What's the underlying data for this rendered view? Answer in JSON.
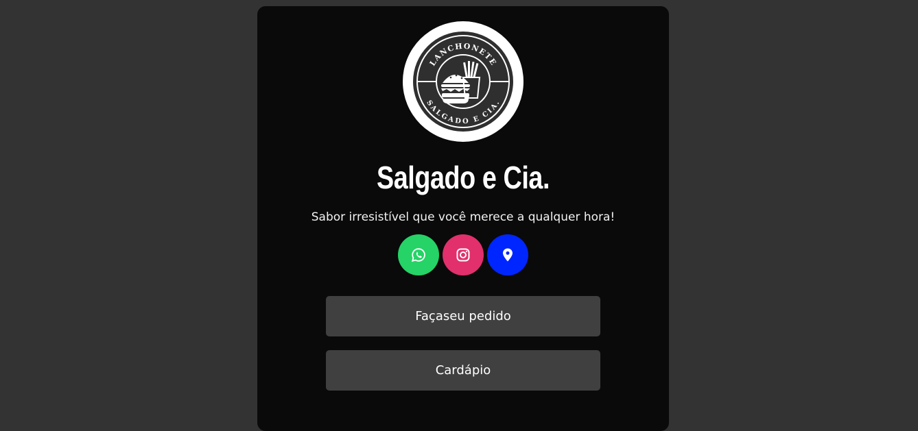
{
  "brand": {
    "logo_ring_text_top": "LANCHONETE",
    "logo_ring_text_bottom": "SALGADO E CIA.",
    "title": "Salgado e Cia.",
    "tagline": "Sabor irresistível que você merece a qualquer hora!"
  },
  "social": [
    {
      "name": "whatsapp",
      "icon": "whatsapp-icon",
      "color": "#25d366"
    },
    {
      "name": "instagram",
      "icon": "instagram-icon",
      "color": "#e1306c"
    },
    {
      "name": "location",
      "icon": "location-pin-icon",
      "color": "#0026ff"
    }
  ],
  "buttons": {
    "order_label": "Façaseu pedido",
    "menu_label": "Cardápio"
  },
  "colors": {
    "page_bg": "#333333",
    "card_bg": "#0a0a0a",
    "button_bg": "#404040"
  }
}
